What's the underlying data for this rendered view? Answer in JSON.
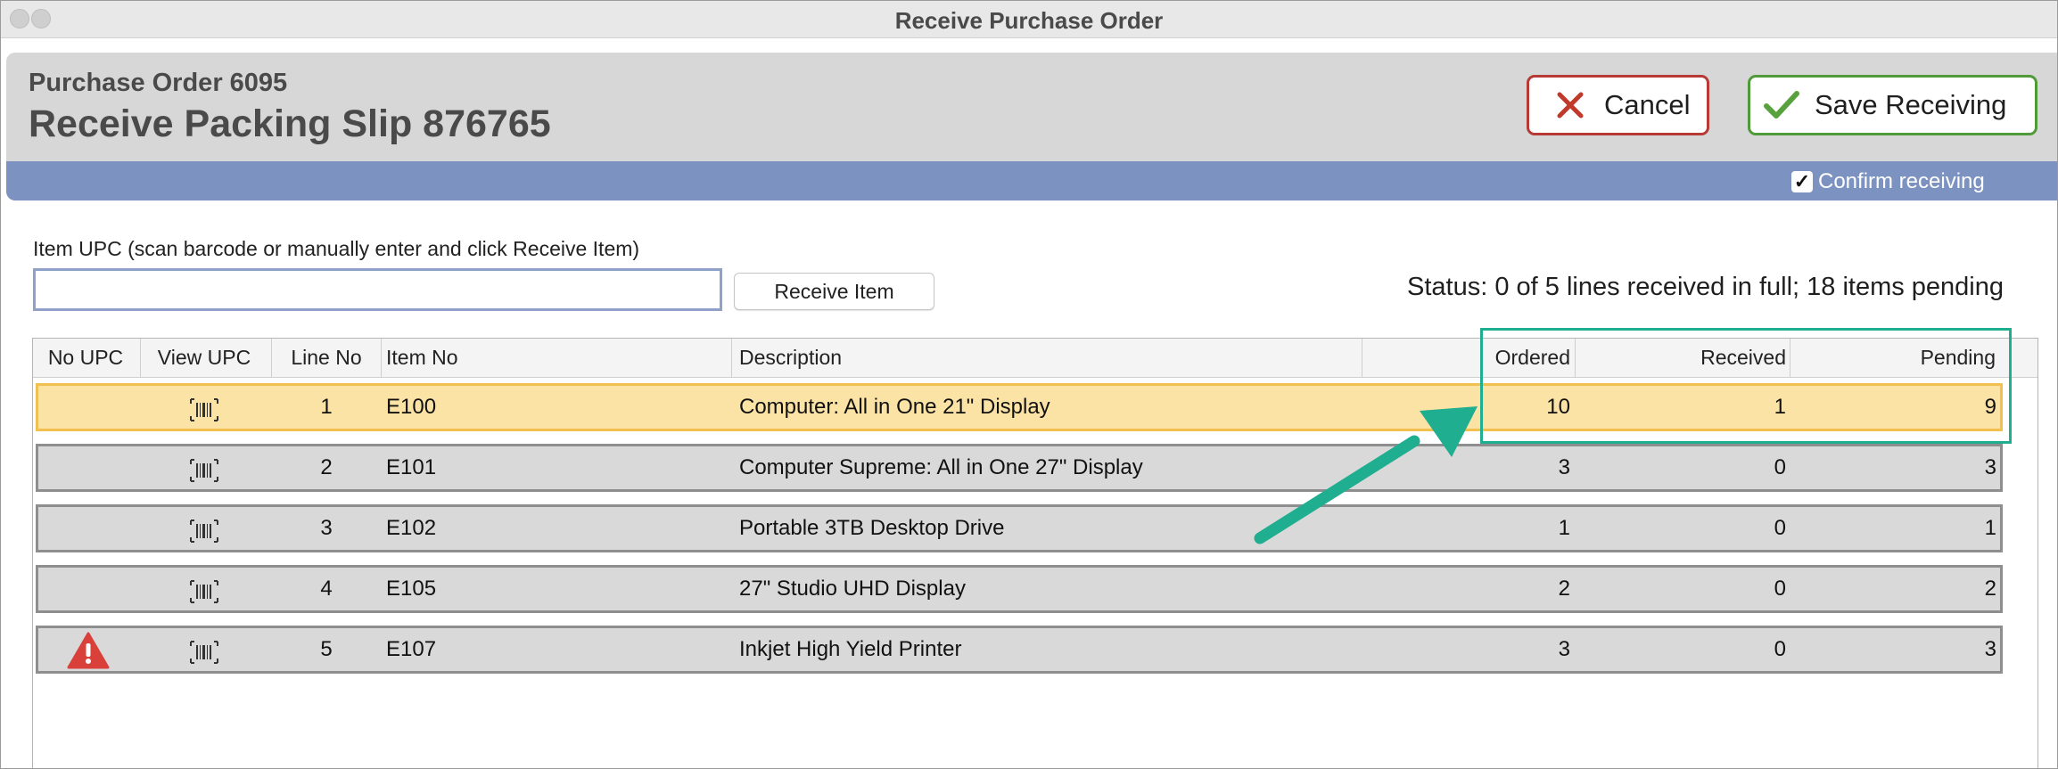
{
  "window": {
    "title": "Receive Purchase Order"
  },
  "header": {
    "purchase_order": "Purchase Order 6095",
    "packing_slip": "Receive Packing Slip 876765",
    "cancel_label": "Cancel",
    "save_label": "Save Receiving",
    "confirm_label": "Confirm receiving",
    "confirm_checked": true
  },
  "scan": {
    "label": "Item UPC (scan barcode or manually enter and click Receive Item)",
    "value": "",
    "button_label": "Receive Item"
  },
  "status": "Status: 0 of 5 lines received in full; 18 items pending",
  "table": {
    "columns": {
      "no_upc": "No UPC",
      "view_upc": "View UPC",
      "line_no": "Line No",
      "item_no": "Item No",
      "description": "Description",
      "ordered": "Ordered",
      "received": "Received",
      "pending": "Pending"
    },
    "rows": [
      {
        "line": "1",
        "item": "E100",
        "description": "Computer: All in One 21\" Display",
        "ordered": "10",
        "received": "1",
        "pending": "9",
        "selected": true,
        "no_upc_warning": false
      },
      {
        "line": "2",
        "item": "E101",
        "description": "Computer Supreme: All in One 27\" Display",
        "ordered": "3",
        "received": "0",
        "pending": "3",
        "selected": false,
        "no_upc_warning": false
      },
      {
        "line": "3",
        "item": "E102",
        "description": "Portable 3TB Desktop Drive",
        "ordered": "1",
        "received": "0",
        "pending": "1",
        "selected": false,
        "no_upc_warning": false
      },
      {
        "line": "4",
        "item": "E105",
        "description": "27\" Studio UHD Display",
        "ordered": "2",
        "received": "0",
        "pending": "2",
        "selected": false,
        "no_upc_warning": false
      },
      {
        "line": "5",
        "item": "E107",
        "description": "Inkjet High Yield Printer",
        "ordered": "3",
        "received": "0",
        "pending": "3",
        "selected": false,
        "no_upc_warning": true
      }
    ]
  },
  "colors": {
    "accent_bar": "#7c92c0",
    "selected_row": "#fbe3a5",
    "callout": "#1fae8f",
    "cancel": "#b73a35",
    "save": "#4f9b3a",
    "warning": "#d9403a"
  },
  "icons": {
    "cancel": "x-icon",
    "save": "checkmark-icon",
    "upc": "barcode-icon",
    "warning": "warning-triangle-icon"
  }
}
